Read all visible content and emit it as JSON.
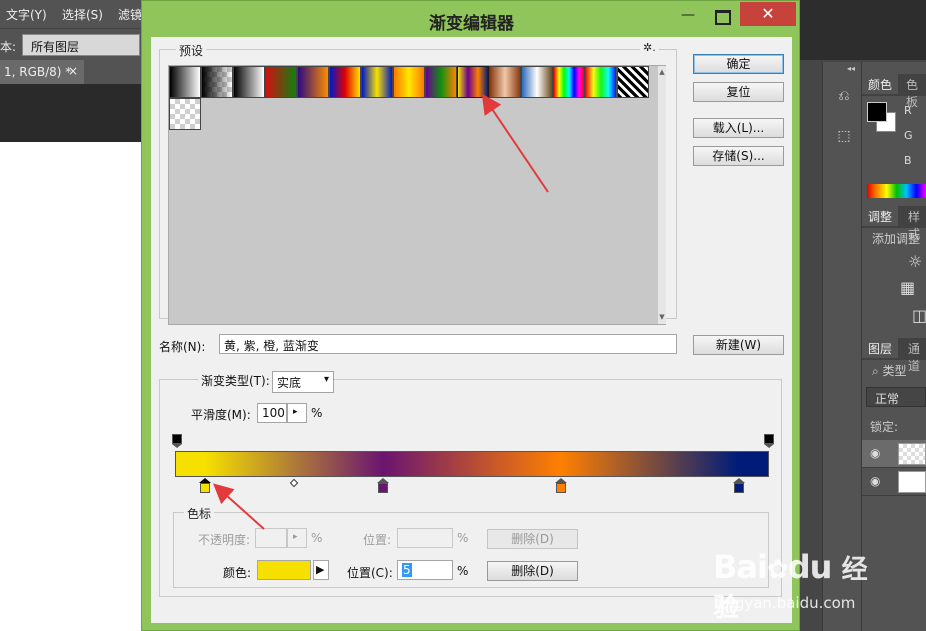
{
  "ps": {
    "menu": [
      "文字(Y)",
      "选择(S)",
      "滤镜"
    ],
    "options_label": "本:",
    "options_select": "所有图层",
    "doc_tab": "1, RGB/8) *",
    "doc_tab_close": "×",
    "panels": {
      "color_tab": "颜色",
      "color_tab2": "色板",
      "channels": [
        "R",
        "G",
        "B"
      ],
      "adjust_tab": "调整",
      "adjust_tab2": "样式",
      "adjust_label": "添加调整",
      "layers_tab": "图层",
      "layers_tab2": "通道",
      "search_label": "类型",
      "blend_mode": "正常",
      "lock_label": "锁定:"
    }
  },
  "dialog": {
    "title": "渐变编辑器",
    "min_glyph": "—",
    "close_glyph": "✕",
    "presets_label": "预设",
    "gear_glyph": "✲.",
    "buttons": {
      "ok": "确定",
      "reset": "复位",
      "load": "载入(L)...",
      "save": "存储(S)..."
    },
    "presets": [
      {
        "name": "foreground-to-background",
        "colors": [
          "#000000",
          "#ffffff"
        ]
      },
      {
        "name": "foreground-to-transparent",
        "colors": [
          "#000000",
          "transparent"
        ]
      },
      {
        "name": "black-white",
        "colors": [
          "#000000",
          "#ffffff"
        ]
      },
      {
        "name": "red-green",
        "colors": [
          "#d01010",
          "#108010"
        ]
      },
      {
        "name": "violet-orange",
        "colors": [
          "#2a0a80",
          "#ff8c00"
        ]
      },
      {
        "name": "blue-red-yellow",
        "colors": [
          "#0018c8",
          "#e00000",
          "#ffe000"
        ]
      },
      {
        "name": "blue-yellow-blue",
        "colors": [
          "#0018c8",
          "#f8e000",
          "#0018c8"
        ]
      },
      {
        "name": "orange-yellow-orange",
        "colors": [
          "#ff7800",
          "#ffe800",
          "#ff7800"
        ]
      },
      {
        "name": "violet-green-orange",
        "colors": [
          "#6a0090",
          "#109010",
          "#ff8000"
        ]
      },
      {
        "name": "yellow-violet-orange-blue",
        "colors": [
          "#f5e000",
          "#6a0090",
          "#ff8000",
          "#001c78"
        ]
      },
      {
        "name": "copper",
        "colors": [
          "#8a3b12",
          "#f0c8a8",
          "#8a3b12"
        ]
      },
      {
        "name": "chrome",
        "colors": [
          "#2a6ab8",
          "#ffffff",
          "#6a4a1a"
        ]
      },
      {
        "name": "spectrum",
        "colors": [
          "#ff0000",
          "#ffff00",
          "#00ff00",
          "#00ffff",
          "#0000ff",
          "#ff00ff",
          "#ff0000"
        ]
      },
      {
        "name": "transparent-rainbow",
        "colors": [
          "#ff0000",
          "#ffff00",
          "#00ff00",
          "#00ffff",
          "#0000ff"
        ]
      },
      {
        "name": "transparent-stripes",
        "colors": [
          "#000000",
          "#ffffff"
        ]
      },
      {
        "name": "neutral-density",
        "colors": [
          "transparent",
          "transparent"
        ]
      }
    ],
    "name_label": "名称(N):",
    "name_value": "黄, 紫, 橙, 蓝渐变",
    "new_button": "新建(W)",
    "type_label": "渐变类型(T):",
    "type_value": "实底",
    "type_caret": "▾",
    "smooth_label": "平滑度(M):",
    "smooth_value": "100",
    "smooth_spinner": "▸",
    "smooth_unit": "%",
    "gradient_colors": [
      "#f5e000",
      "#6a1570",
      "#ff8000",
      "#001c78"
    ],
    "gradient_stops_pct": [
      5,
      35,
      65,
      95
    ],
    "stops_legend": "色标",
    "opacity_label": "不透明度:",
    "opacity_spinner": "▸",
    "opacity_unit": "%",
    "position_label_top": "位置:",
    "position_unit_top": "%",
    "delete_top": "删除(D)",
    "color_label": "颜色:",
    "color_value": "#f5e000",
    "color_arrow": "▶",
    "position_label": "位置(C):",
    "position_value": "5",
    "position_unit": "%",
    "delete_bottom": "删除(D)"
  },
  "watermark": {
    "brand": "Bai",
    "brand2": "du",
    "brand_cn": "经验",
    "url": "jingyan.baidu.com"
  }
}
